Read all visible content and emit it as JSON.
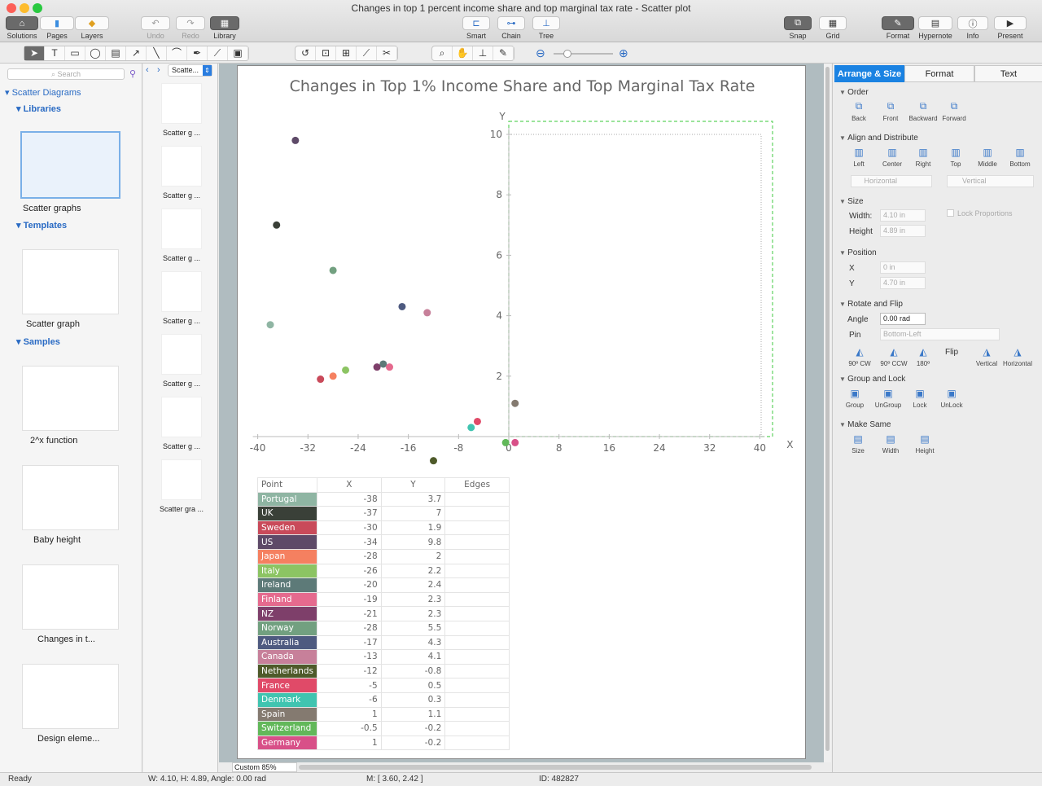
{
  "window": {
    "title": "Changes in top 1 percent income share and top marginal tax rate - Scatter plot"
  },
  "toolbar": {
    "solutions": "Solutions",
    "pages": "Pages",
    "layers": "Layers",
    "undo": "Undo",
    "redo": "Redo",
    "library": "Library",
    "smart": "Smart",
    "chain": "Chain",
    "tree": "Tree",
    "snap": "Snap",
    "grid": "Grid",
    "format": "Format",
    "hypernote": "Hypernote",
    "info": "Info",
    "present": "Present"
  },
  "left": {
    "search_placeholder": "Search",
    "root": "Scatter Diagrams",
    "libraries": "Libraries",
    "lib_item": "Scatter graphs",
    "templates": "Templates",
    "tpl_item": "Scatter graph",
    "samples": "Samples",
    "sample_items": [
      "2^x function",
      "Baby height",
      "Changes in t...",
      "Design eleme..."
    ]
  },
  "thumbs": {
    "selector": "Scatte...",
    "items": [
      "Scatter g ...",
      "Scatter g ...",
      "Scatter g ...",
      "Scatter g ...",
      "Scatter g ...",
      "Scatter g ...",
      "Scatter gra ..."
    ]
  },
  "chart_data": {
    "type": "scatter",
    "title": "Changes in Top 1% Income Share and Top Marginal Tax Rate",
    "xlabel": "X",
    "ylabel": "Y",
    "xlim": [
      -40,
      40
    ],
    "ylim": [
      0,
      10
    ],
    "xticks": [
      "-40",
      "-32",
      "-24",
      "-16",
      "-8",
      "0",
      "8",
      "16",
      "24",
      "32",
      "40"
    ],
    "xtick_values": [
      -40,
      -32,
      -24,
      -16,
      -8,
      0,
      8,
      16,
      24,
      32,
      40
    ],
    "yticks": [
      "2",
      "4",
      "6",
      "8",
      "10"
    ],
    "ytick_values": [
      2,
      4,
      6,
      8,
      10
    ],
    "headers": [
      "Point",
      "X",
      "Y",
      "Edges"
    ],
    "points": [
      {
        "name": "Portugal",
        "x": "-38",
        "y": "3.7",
        "color": "#8fb5a3"
      },
      {
        "name": "UK",
        "x": "-37",
        "y": "7",
        "color": "#3a4038"
      },
      {
        "name": "Sweden",
        "x": "-30",
        "y": "1.9",
        "color": "#c94a5a"
      },
      {
        "name": "US",
        "x": "-34",
        "y": "9.8",
        "color": "#5e4a68"
      },
      {
        "name": "Japan",
        "x": "-28",
        "y": "2",
        "color": "#f58060"
      },
      {
        "name": "Italy",
        "x": "-26",
        "y": "2.2",
        "color": "#8cc463"
      },
      {
        "name": "Ireland",
        "x": "-20",
        "y": "2.4",
        "color": "#5d7a78"
      },
      {
        "name": "Finland",
        "x": "-19",
        "y": "2.3",
        "color": "#e56a8e"
      },
      {
        "name": "NZ",
        "x": "-21",
        "y": "2.3",
        "color": "#7e3f6a"
      },
      {
        "name": "Norway",
        "x": "-28",
        "y": "5.5",
        "color": "#72a080"
      },
      {
        "name": "Australia",
        "x": "-17",
        "y": "4.3",
        "color": "#4e5a80"
      },
      {
        "name": "Canada",
        "x": "-13",
        "y": "4.1",
        "color": "#c7809a"
      },
      {
        "name": "Netherlands",
        "x": "-12",
        "y": "-0.8",
        "color": "#4e5a2a"
      },
      {
        "name": "France",
        "x": "-5",
        "y": "0.5",
        "color": "#e04a68"
      },
      {
        "name": "Denmark",
        "x": "-6",
        "y": "0.3",
        "color": "#40c4b0"
      },
      {
        "name": "Spain",
        "x": "1",
        "y": "1.1",
        "color": "#847a70"
      },
      {
        "name": "Switzerland",
        "x": "-0.5",
        "y": "-0.2",
        "color": "#62b85a"
      },
      {
        "name": "Germany",
        "x": "1",
        "y": "-0.2",
        "color": "#d85088"
      }
    ]
  },
  "right": {
    "tabs": [
      "Arrange & Size",
      "Format",
      "Text"
    ],
    "order": "Order",
    "order_btns": [
      "Back",
      "Front",
      "Backward",
      "Forward"
    ],
    "align": "Align and Distribute",
    "align_btns": [
      "Left",
      "Center",
      "Right",
      "Top",
      "Middle",
      "Bottom"
    ],
    "horizontal": "Horizontal",
    "vertical": "Vertical",
    "size": "Size",
    "width_label": "Width:",
    "width": "4.10 in",
    "height_label": "Height",
    "height": "4.89 in",
    "lock": "Lock Proportions",
    "position": "Position",
    "x_label": "X",
    "x": "0 in",
    "y_label": "Y",
    "y": "4.70 in",
    "rotate": "Rotate and Flip",
    "angle_label": "Angle",
    "angle": "0.00 rad",
    "pin_label": "Pin",
    "pin": "Bottom-Left",
    "rot_btns": [
      "90º CW",
      "90º CCW",
      "180º"
    ],
    "flip": "Flip",
    "flip_btns": [
      "Vertical",
      "Horizontal"
    ],
    "group": "Group and Lock",
    "group_btns": [
      "Group",
      "UnGroup",
      "Lock",
      "UnLock"
    ],
    "same": "Make Same",
    "same_btns": [
      "Size",
      "Width",
      "Height"
    ]
  },
  "status": {
    "ready": "Ready",
    "dims": "W: 4.10,  H: 4.89,  Angle: 0.00 rad",
    "mouse": "M: [ 3.60, 2.42 ]",
    "id": "ID: 482827",
    "zoom": "Custom 85%"
  }
}
